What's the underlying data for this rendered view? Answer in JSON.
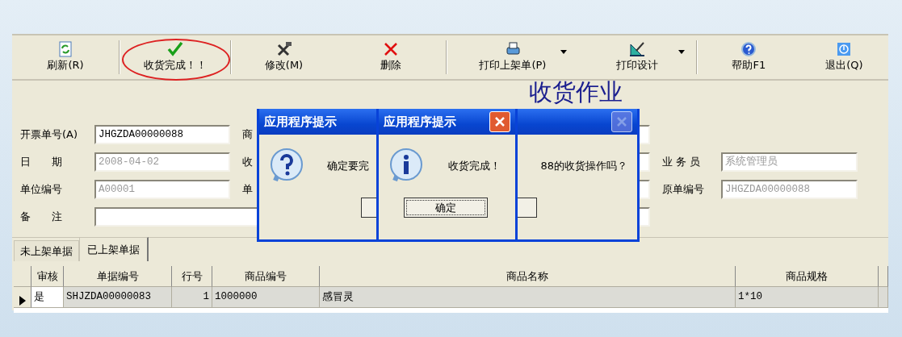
{
  "toolbar": [
    {
      "label": "刷新(R)"
    },
    {
      "label": "收货完成！！",
      "circled": true
    },
    {
      "label": "修改(M)"
    },
    {
      "label": "删除"
    },
    {
      "label": "打印上架单(P)",
      "dropdown": true
    },
    {
      "label": "打印设计",
      "dropdown": true
    },
    {
      "label": "帮助F1"
    },
    {
      "label": "退出(Q)"
    }
  ],
  "form": {
    "title": "收货作业",
    "rows": [
      {
        "label": "开票单号(A)",
        "value": "JHGZDA00000088",
        "disabled": false,
        "mid_label": "商"
      },
      {
        "label": "日　　期",
        "value": "2008-04-02",
        "disabled": true,
        "mid_label": "收",
        "right_label": "业 务 员",
        "right_value": "系统管理员"
      },
      {
        "label": "单位编号",
        "value": "A00001",
        "disabled": true,
        "mid_label": "单",
        "right_label": "原单编号",
        "right_value": "JHGZDA00000088"
      },
      {
        "label": "备　　注"
      }
    ]
  },
  "tabs": [
    {
      "label": "未上架单据",
      "selected": false
    },
    {
      "label": "已上架单据",
      "selected": true
    }
  ],
  "table": {
    "columns": [
      "审核",
      "单据编号",
      "行号",
      "商品编号",
      "商品名称",
      "商品规格"
    ],
    "rows": [
      {
        "selected": true,
        "cells": [
          "是",
          "SHJZDA00000083",
          "1",
          "1000000",
          "感冒灵",
          "1*10"
        ]
      }
    ]
  },
  "dialogs": [
    {
      "title": "应用程序提示",
      "close_enabled": false,
      "message_start": "确定要完",
      "message_end": "88的收货操作吗？"
    },
    {
      "title": "应用程序提示",
      "close_enabled": true,
      "message_start": "收货完成！",
      "button": "确定"
    }
  ]
}
